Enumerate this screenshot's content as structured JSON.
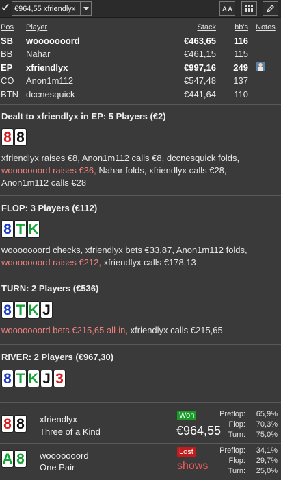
{
  "toolbar": {
    "hand_select": "€964,55 xfriendlyx",
    "font_button": "A A"
  },
  "players_header": {
    "pos": "Pos",
    "player": "Player",
    "stack": "Stack",
    "bbs": "bb's",
    "notes": "Notes"
  },
  "players": [
    {
      "pos": "SB",
      "name": "wooooooord",
      "stack": "€463,65",
      "bbs": "116",
      "bold": true
    },
    {
      "pos": "BB",
      "name": "Nahar",
      "stack": "€461,15",
      "bbs": "115",
      "bold": false
    },
    {
      "pos": "EP",
      "name": "xfriendlyx",
      "stack": "€997,16",
      "bbs": "249",
      "bold": true
    },
    {
      "pos": "CO",
      "name": "Anon1m112",
      "stack": "€547,48",
      "bbs": "137",
      "bold": false
    },
    {
      "pos": "BTN",
      "name": "dccnesquick",
      "stack": "€441,64",
      "bbs": "110",
      "bold": false
    }
  ],
  "preflop": {
    "title": "Dealt to xfriendlyx in EP: 5 Players (€2)",
    "cards": [
      {
        "rank": "8",
        "suit": "h"
      },
      {
        "rank": "8",
        "suit": "s"
      }
    ],
    "line1": "xfriendlyx raises €8, Anon1m112 calls €8, dccnesquick folds,",
    "line2_raise": "wooooooord raises €36,",
    "line2_rest": " Nahar folds, xfriendlyx calls €28,",
    "line3": "Anon1m112 calls €28"
  },
  "flop": {
    "title": "FLOP: 3 Players (€112)",
    "cards": [
      {
        "rank": "8",
        "suit": "d"
      },
      {
        "rank": "T",
        "suit": "c"
      },
      {
        "rank": "K",
        "suit": "c"
      }
    ],
    "line1": "wooooooord checks, xfriendlyx bets €33,87, Anon1m112 folds,",
    "line2_raise": "wooooooord raises €212,",
    "line2_rest": " xfriendlyx calls €178,13"
  },
  "turn": {
    "title": "TURN: 2 Players (€536)",
    "cards": [
      {
        "rank": "8",
        "suit": "d"
      },
      {
        "rank": "T",
        "suit": "c"
      },
      {
        "rank": "K",
        "suit": "c"
      },
      {
        "rank": "J",
        "suit": "s"
      }
    ],
    "line1_raise": "wooooooord bets €215,65 all-in,",
    "line1_rest": " xfriendlyx calls €215,65"
  },
  "river": {
    "title": "RIVER: 2 Players (€967,30)",
    "cards": [
      {
        "rank": "8",
        "suit": "d"
      },
      {
        "rank": "T",
        "suit": "c"
      },
      {
        "rank": "K",
        "suit": "c"
      },
      {
        "rank": "J",
        "suit": "s"
      },
      {
        "rank": "3",
        "suit": "h"
      }
    ]
  },
  "results": [
    {
      "cards": [
        {
          "rank": "8",
          "suit": "h"
        },
        {
          "rank": "8",
          "suit": "s"
        }
      ],
      "name": "xfriendlyx",
      "hand": "Three of a Kind",
      "badge": "Won",
      "amount": "€964,55",
      "preflop_label": "Preflop:",
      "preflop": "65,9%",
      "flop_label": "Flop:",
      "flop": "70,3%",
      "turn_label": "Turn:",
      "turn": "75,0%"
    },
    {
      "cards": [
        {
          "rank": "A",
          "suit": "c"
        },
        {
          "rank": "8",
          "suit": "c"
        }
      ],
      "name": "wooooooord",
      "hand": "One Pair",
      "badge": "Lost",
      "amount": "shows",
      "preflop_label": "Preflop:",
      "preflop": "34,1%",
      "flop_label": "Flop:",
      "flop": "29,7%",
      "turn_label": "Turn:",
      "turn": "25,0%"
    }
  ],
  "colors": {
    "background": "#3a3a3a",
    "hero_raise": "#ef7f7f",
    "won": "#1a9b27",
    "lost": "#c11b1b",
    "diamonds": "#1e3ec8",
    "hearts": "#d41e1e",
    "clubs": "#15a535",
    "spades": "#111111"
  },
  "icons": {
    "checkbox": "check-icon",
    "dropdown": "chevron-down-icon",
    "font_size": "font-size-icon",
    "grid": "grid-icon",
    "edit": "pencil-icon",
    "note": "note-icon"
  }
}
